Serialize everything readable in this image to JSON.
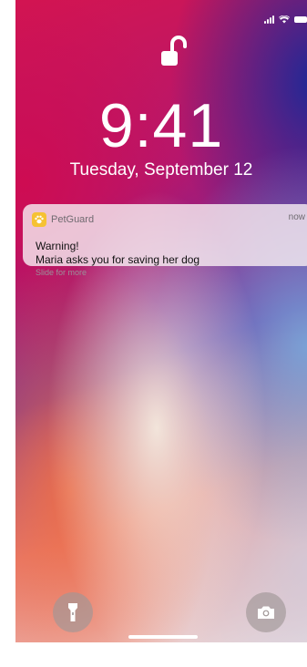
{
  "status_bar": {
    "icons": [
      "signal-bars-icon",
      "wifi-icon",
      "battery-icon"
    ]
  },
  "lock_screen": {
    "lock_icon": "unlocked-padlock-icon",
    "time": "9:41",
    "date": "Tuesday, September 12"
  },
  "notification": {
    "app_icon": "paw-icon",
    "app_name": "PetGuard",
    "time": "now",
    "title": "Warning!",
    "body": "Maria asks you for saving her dog",
    "hint": "Slide for more"
  },
  "quick_actions": {
    "left_icon": "flashlight-icon",
    "right_icon": "camera-icon"
  },
  "colors": {
    "wallpaper_red": "#d31551",
    "wallpaper_blue": "#1e2896",
    "app_icon_yellow": "#f6c233",
    "notification_bg": "#f5ebf0"
  }
}
